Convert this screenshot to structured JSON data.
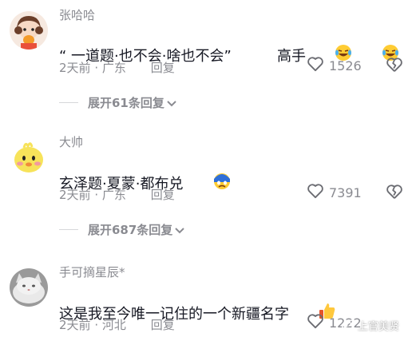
{
  "comments": [
    {
      "username": "张哈哈",
      "content": "“ 一道题·也不会·啥也不会”          高手",
      "content_emoji": [
        "laughing-crying-emoji",
        "laughing-crying-emoji"
      ],
      "time": "2天前",
      "location": "广东",
      "reply": "回复",
      "likes": "1526",
      "expand": "展开61条回复"
    },
    {
      "username": "大帅",
      "content": "玄泽题·夏蒙·都布兑",
      "content_emoji": [
        "crying-face-emoji"
      ],
      "time": "2天前",
      "location": "广东",
      "reply": "回复",
      "likes": "7391",
      "expand": "展开687条回复"
    },
    {
      "username": "手可摘星辰*",
      "content": "这是我至今唯一记住的一个新疆名字",
      "content_emoji": [
        "thumbs-up-emoji"
      ],
      "time": "2天前",
      "location": "河北",
      "reply": "回复",
      "likes": "1222"
    }
  ],
  "watermark": "上官美贤",
  "colors": {
    "text": "#161823",
    "meta": "#8a8b91"
  }
}
